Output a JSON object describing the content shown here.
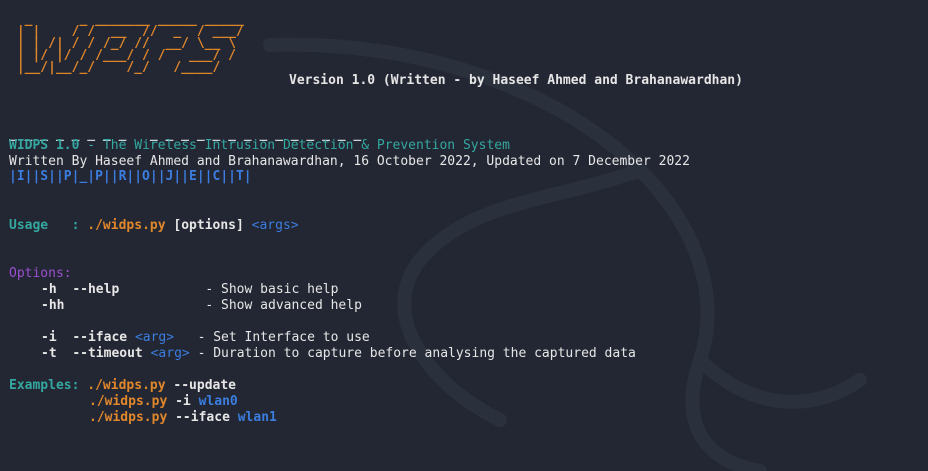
{
  "ascii_logo": [
    "  _      _ _______ _____ _____",
    " | |    / /  __  //  _  / ___/",
    " | | /| / / /_/ //  __/ \\__ \\ ",
    " | |/ |/ / /___/ / /   ___/ / ",
    " |__/|__/_/    /_/   /____/   "
  ],
  "version_line": "Version 1.0 (Written - by Haseef Ahmed and Brahanawardhan)",
  "banner_dashes": "_ _ _ _ _ _ _ _   _ _ _ _ _ _ _ _ _ _ _ _ _ _",
  "banner_boxes": "|I||S||P|_|P||R||O||J||E||C||T|",
  "title": {
    "name": "WIDPS 1.0",
    "sep": " - ",
    "tagline": "The Wireless Intrusion Detection & Prevention System"
  },
  "written_line": "Written By Haseef Ahmed and Brahanawardhan, 16 October 2022, Updated on 7 December 2022",
  "usage": {
    "label": "Usage   : ",
    "cmd": "./widps.py",
    "options": " [options] ",
    "args": "<args>"
  },
  "options": {
    "header": "Options:",
    "items": [
      {
        "short": "-h",
        "long": "--help",
        "arg": "",
        "pad": "           ",
        "desc": "- Show basic help"
      },
      {
        "short": "-hh",
        "long": "",
        "arg": "",
        "pad": "                  ",
        "desc": "- Show advanced help"
      },
      {
        "short": "-i",
        "long": "--iface",
        "arg": "<arg>",
        "pad": "   ",
        "desc": "- Set Interface to use"
      },
      {
        "short": "-t",
        "long": "--timeout",
        "arg": "<arg>",
        "pad": " ",
        "desc": "- Duration to capture before analysing the captured data"
      }
    ]
  },
  "examples": {
    "header": "Examples: ",
    "items": [
      {
        "cmd": "./widps.py",
        "flag": " --update",
        "val": ""
      },
      {
        "cmd": "./widps.py",
        "flag": " -i ",
        "val": "wlan0"
      },
      {
        "cmd": "./widps.py",
        "flag": " --iface ",
        "val": "wlan1"
      }
    ]
  },
  "colors": {
    "background": "#232733",
    "orange": "#e0872b",
    "teal": "#34a7a0",
    "blue": "#3b7de0",
    "purple": "#9b4fd0"
  }
}
